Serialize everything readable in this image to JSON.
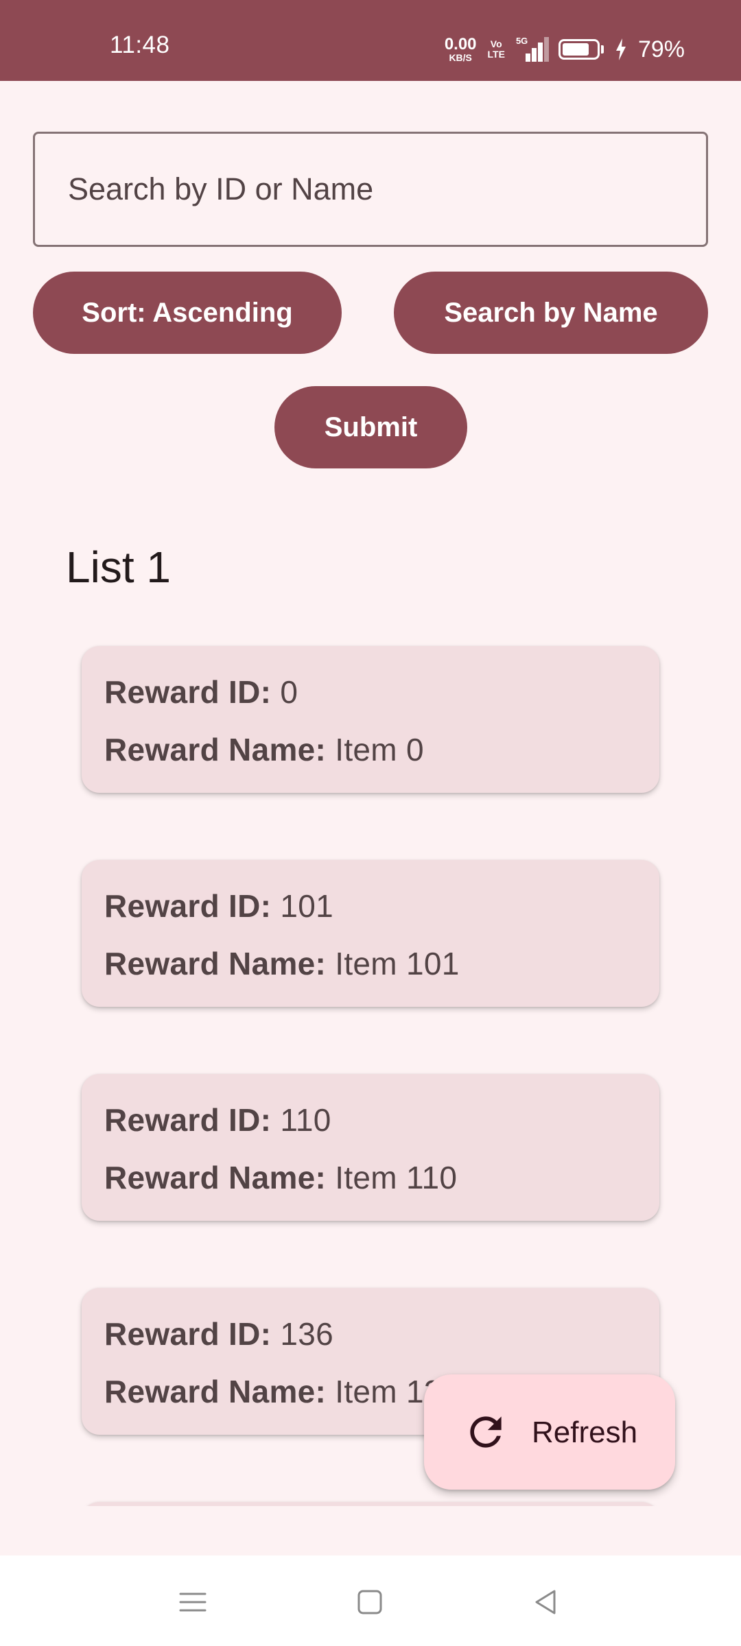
{
  "status_bar": {
    "time": "11:48",
    "net_speed_value": "0.00",
    "net_speed_unit": "KB/S",
    "volte_top": "Vo",
    "volte_bottom": "LTE",
    "network": "5G",
    "battery_percent": "79%",
    "battery_level": 0.79,
    "background_color": "#8e4953"
  },
  "search": {
    "placeholder": "Search by ID or Name",
    "value": ""
  },
  "buttons": {
    "sort_label": "Sort: Ascending",
    "search_mode_label": "Search by Name",
    "submit_label": "Submit"
  },
  "list": {
    "title": "List 1",
    "id_label": "Reward ID:",
    "name_label": "Reward Name:",
    "items": [
      {
        "id": "0",
        "name": "Item 0"
      },
      {
        "id": "101",
        "name": "Item 101"
      },
      {
        "id": "110",
        "name": "Item 110"
      },
      {
        "id": "136",
        "name": "Item 136"
      }
    ]
  },
  "fab": {
    "label": "Refresh",
    "icon": "refresh-icon"
  },
  "nav_bar": {
    "icons": [
      "menu-icon",
      "home-icon",
      "back-icon"
    ]
  },
  "colors": {
    "primary": "#8e4953",
    "background": "#fdf2f3",
    "card": "#f2dde0",
    "fab": "#ffd9de"
  }
}
